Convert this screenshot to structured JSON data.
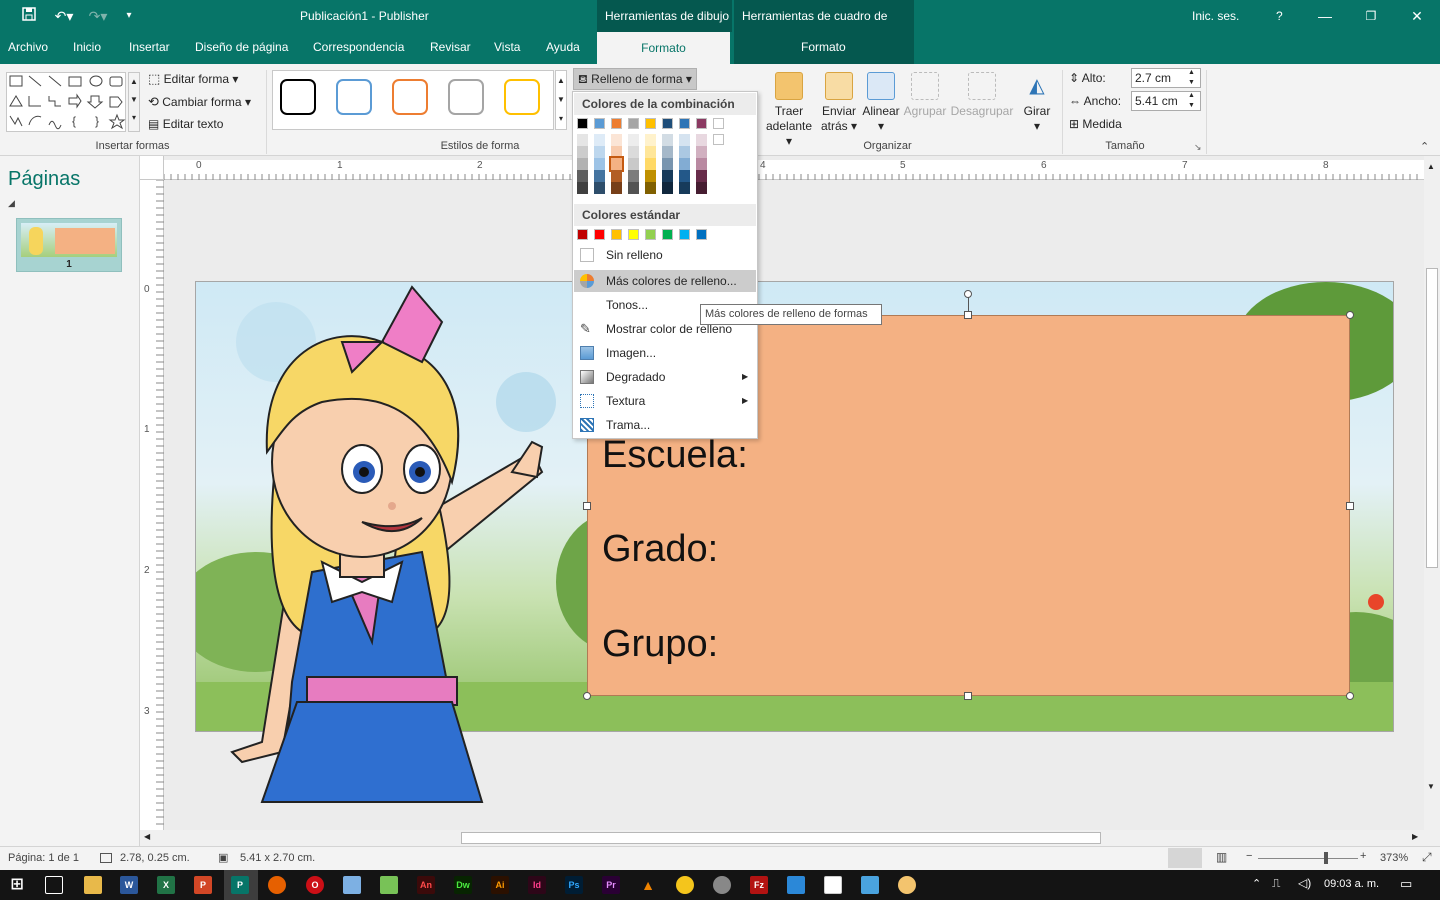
{
  "title": {
    "app": "Publicación1  -  Publisher",
    "context_drawing": "Herramientas de dibujo",
    "context_textbox": "Herramientas de cuadro de texto",
    "signin": "Inic. ses.",
    "help": "?"
  },
  "tabs": [
    {
      "label": "Archivo"
    },
    {
      "label": "Inicio"
    },
    {
      "label": "Insertar"
    },
    {
      "label": "Diseño de página"
    },
    {
      "label": "Correspondencia"
    },
    {
      "label": "Revisar"
    },
    {
      "label": "Vista"
    },
    {
      "label": "Ayuda"
    },
    {
      "label": "Formato"
    },
    {
      "label": "Formato"
    }
  ],
  "ribbon": {
    "insert_shapes": {
      "edit_shape": "Editar forma",
      "change_shape": "Cambiar forma",
      "edit_text": "Editar texto",
      "group_label": "Insertar formas"
    },
    "shape_styles": {
      "group_label": "Estilos de forma",
      "style_colors": [
        "#000000",
        "#5b9bd5",
        "#ed7d31",
        "#a5a5a5",
        "#ffc000"
      ]
    },
    "shape_fill_button": "Relleno de forma",
    "arrange": {
      "bring_forward_1": "Traer",
      "bring_forward_2": "adelante",
      "send_backward_1": "Enviar",
      "send_backward_2": "atrás",
      "align": "Alinear",
      "group": "Agrupar",
      "ungroup": "Desagrupar",
      "rotate": "Girar",
      "group_label": "Organizar"
    },
    "size": {
      "height_label": "Alto:",
      "height_value": "2.7 cm",
      "width_label": "Ancho:",
      "width_value": "5.41 cm",
      "measure": "Medida",
      "group_label": "Tamaño"
    }
  },
  "pages_pane": {
    "title": "Páginas",
    "page_number": "1"
  },
  "ruler": {
    "h_numbers": [
      "0",
      "1",
      "2",
      "3",
      "4",
      "5",
      "6",
      "7",
      "8"
    ],
    "v_numbers": [
      "0",
      "1",
      "2",
      "3"
    ]
  },
  "dropdown": {
    "scheme_header": "Colores de la combinación",
    "scheme_colors": [
      "#000000",
      "#5b9bd5",
      "#ed7d31",
      "#a5a5a5",
      "#ffc000",
      "#1f4e79",
      "#2e75b6",
      "#8b3a62",
      "#ffffff"
    ],
    "standard_header": "Colores estándar",
    "standard_colors": [
      "#c00000",
      "#ff0000",
      "#ffc000",
      "#ffff00",
      "#92d050",
      "#00b050",
      "#00b0f0",
      "#0070c0"
    ],
    "items": {
      "no_fill": "Sin relleno",
      "more_colors": "Más colores de relleno...",
      "tints": "Tonos...",
      "sample": "Mostrar color de relleno",
      "picture": "Imagen...",
      "gradient": "Degradado",
      "texture": "Textura",
      "pattern": "Trama..."
    }
  },
  "tooltip": "Más colores de relleno de formas",
  "textbox": {
    "line1": "Escuela:",
    "line2": "Grado:",
    "line3": "Grupo:",
    "fill_color": "#f4b183"
  },
  "status": {
    "page": "Página: 1 de 1",
    "position": "2.78, 0.25 cm.",
    "size": "5.41 x  2.70 cm.",
    "zoom": "373%"
  },
  "taskbar": {
    "time": "09:03 a. m."
  }
}
